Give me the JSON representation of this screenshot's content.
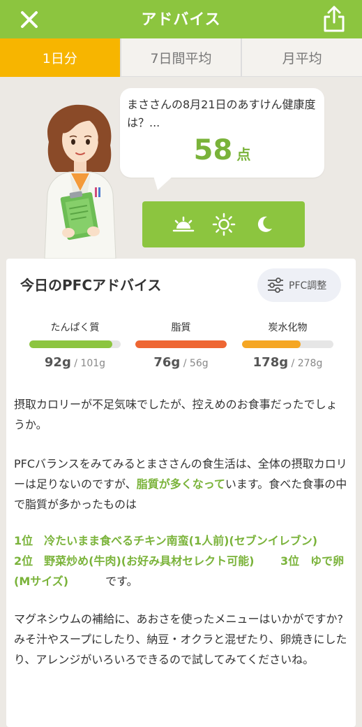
{
  "header": {
    "title": "アドバイス",
    "close_icon": "close-icon",
    "share_icon": "share-icon"
  },
  "tabs": [
    {
      "label": "1日分",
      "active": true
    },
    {
      "label": "7日間平均",
      "active": false
    },
    {
      "label": "月平均",
      "active": false
    }
  ],
  "bubble": {
    "message": "まささんの8月21日のあすけん健康度は？...",
    "score": "58",
    "score_unit": "点"
  },
  "time_of_day": [
    "sunrise-icon",
    "sun-icon",
    "moon-icon"
  ],
  "card": {
    "title": "今日のPFCアドバイス",
    "pfc_button_label": "PFC調整",
    "macros": [
      {
        "label": "たんぱく質",
        "value": "92g",
        "target": " / 101g",
        "fraction": 0.91,
        "color": "#8cc53f"
      },
      {
        "label": "脂質",
        "value": "76g",
        "target": " / 56g",
        "fraction": 1.0,
        "color": "#ee6633"
      },
      {
        "label": "炭水化物",
        "value": "178g",
        "target": " / 278g",
        "fraction": 0.64,
        "color": "#f5a623"
      }
    ],
    "para1": "摂取カロリーが不足気味でしたが、控えめのお食事だったでしょうか。",
    "para2_a": "PFCバランスをみてみるとまささんの食生活は、全体の摂取カロリーは足りないのですが、",
    "para2_highlight": "脂質が多くなって",
    "para2_b": "います。食べた食事の中で脂質が多かったものは",
    "ranking": "1位　冷たいまま食べるチキン南蛮(1人前)(セブンイレブン)　　 2位　野菜炒め(牛肉)(お好み具材セレクト可能)　　 3位　ゆで卵(Mサイズ)",
    "ranking_suffix": "　　　 です。",
    "para3": "マグネシウムの補給に、あおさを使ったメニューはいかがですか?みそ汁やスープにしたり、納豆・オクラと混ぜたり、卵焼きにしたり、アレンジがいろいろできるので試してみてくださいね。"
  }
}
